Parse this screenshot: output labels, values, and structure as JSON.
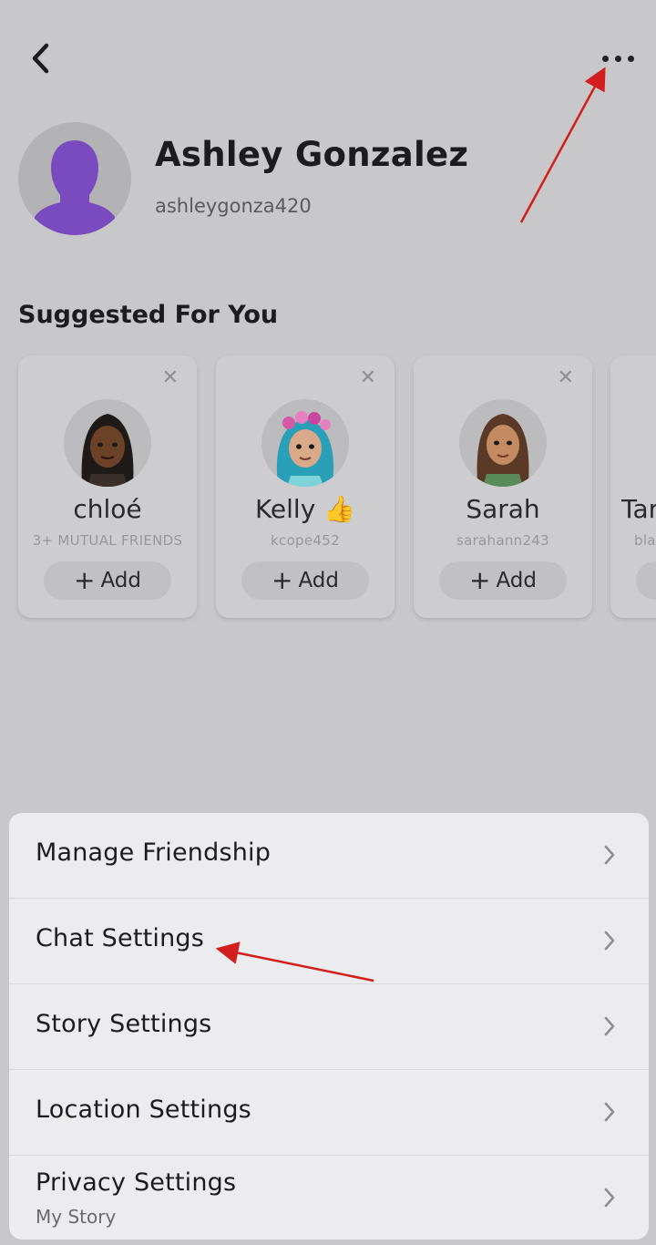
{
  "profile": {
    "name": "Ashley Gonzalez",
    "username": "ashleygonza420"
  },
  "suggested": {
    "title": "Suggested For You",
    "cards": [
      {
        "name": "chloé",
        "subtitle": "3+ MUTUAL FRIENDS",
        "add_label": "Add"
      },
      {
        "name": "Kelly 👍",
        "subtitle": "kcope452",
        "add_label": "Add"
      },
      {
        "name": "Sarah",
        "subtitle": "sarahann243",
        "add_label": "Add"
      },
      {
        "name": "Tar",
        "subtitle": "bla",
        "add_label": ""
      }
    ]
  },
  "menu": {
    "items": [
      {
        "label": "Manage Friendship"
      },
      {
        "label": "Chat Settings"
      },
      {
        "label": "Story Settings"
      },
      {
        "label": "Location Settings"
      },
      {
        "label": "Privacy Settings",
        "sublabel": "My Story"
      }
    ]
  },
  "icons": {
    "back": "chevron-left-icon",
    "more": "more-horizontal-icon",
    "dismiss": "close-icon",
    "chevron": "chevron-right-icon"
  },
  "colors": {
    "avatar_purple": "#7a4bbf",
    "annotation_red": "#d31e1e",
    "overlay_bg": "#c8c8ca",
    "sheet_bg": "#ececee"
  }
}
